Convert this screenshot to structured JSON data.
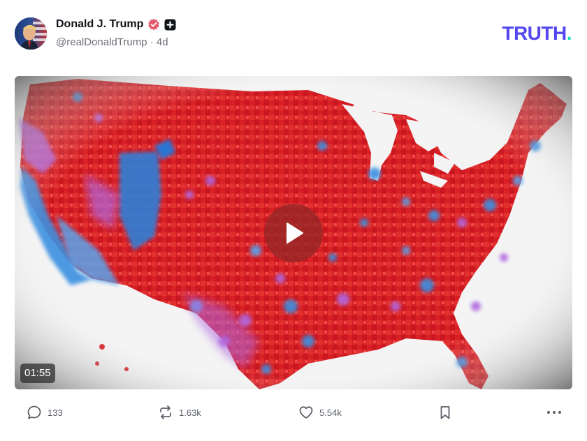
{
  "post": {
    "author": {
      "display_name": "Donald J. Trump",
      "handle": "@realDonaldTrump",
      "separator": " · ",
      "age": "4d",
      "verified_icon": "verified-badge-icon",
      "plus_icon": "plus-badge-icon"
    },
    "brand": {
      "logo_main": "TRUTH",
      "logo_dot": ".",
      "color": "#5448ee",
      "dot_color": "#17e0b8"
    },
    "media": {
      "type": "video",
      "content": "us-county-election-map",
      "duration": "01:55",
      "play_icon": "play-icon"
    },
    "actions": {
      "reply_count": "133",
      "retruth_count": "1.63k",
      "like_count": "5.54k"
    }
  },
  "colors": {
    "map_red": "#d41e24",
    "map_blue": "#3a8fe0",
    "map_purple": "#b068e0"
  }
}
